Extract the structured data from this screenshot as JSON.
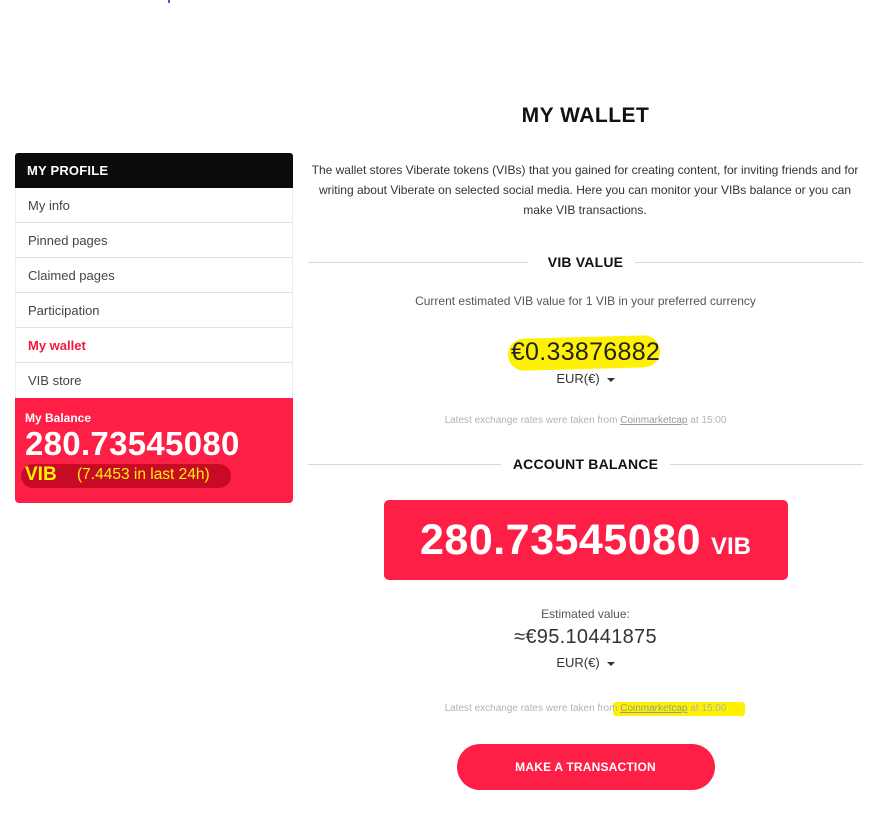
{
  "sidebar": {
    "header": "MY PROFILE",
    "items": [
      {
        "label": "My info"
      },
      {
        "label": "Pinned pages"
      },
      {
        "label": "Claimed pages"
      },
      {
        "label": "Participation"
      },
      {
        "label": "My wallet",
        "active": true
      },
      {
        "label": "VIB store"
      }
    ],
    "balance": {
      "title": "My Balance",
      "amount": "280.73545080",
      "unit": "VIB",
      "change": "(7.4453 in last 24h)"
    }
  },
  "main": {
    "title": "MY WALLET",
    "intro": "The wallet stores Viberate tokens (VIBs) that you gained for creating content, for inviting friends and for writing about Viberate on selected social media. Here you can monitor your VIBs balance or you can make VIB transactions.",
    "vib_value": {
      "heading": "VIB VALUE",
      "subtitle": "Current estimated VIB value for 1 VIB in your preferred currency",
      "value": "€0.33876882",
      "currency": "EUR(€)",
      "rates_prefix": "Latest exchange rates were taken from",
      "rates_link": "Coinmarketcap",
      "rates_suffix": "at 15:00"
    },
    "account_balance": {
      "heading": "ACCOUNT BALANCE",
      "amount": "280.73545080",
      "unit": "VIB",
      "estimated_label": "Estimated value:",
      "estimated_value": "≈€95.10441875",
      "currency": "EUR(€)",
      "rates_prefix": "Latest exchange rates were taken from",
      "rates_link": "Coinmarketcap",
      "rates_suffix": "at 15:00"
    },
    "transaction_button": "MAKE A TRANSACTION"
  },
  "colors": {
    "accent": "#fe1f47",
    "highlight": "#fff200",
    "header_bg": "#0b0b0b"
  },
  "icons": {
    "currency_dropdown": "caret-down-icon"
  }
}
